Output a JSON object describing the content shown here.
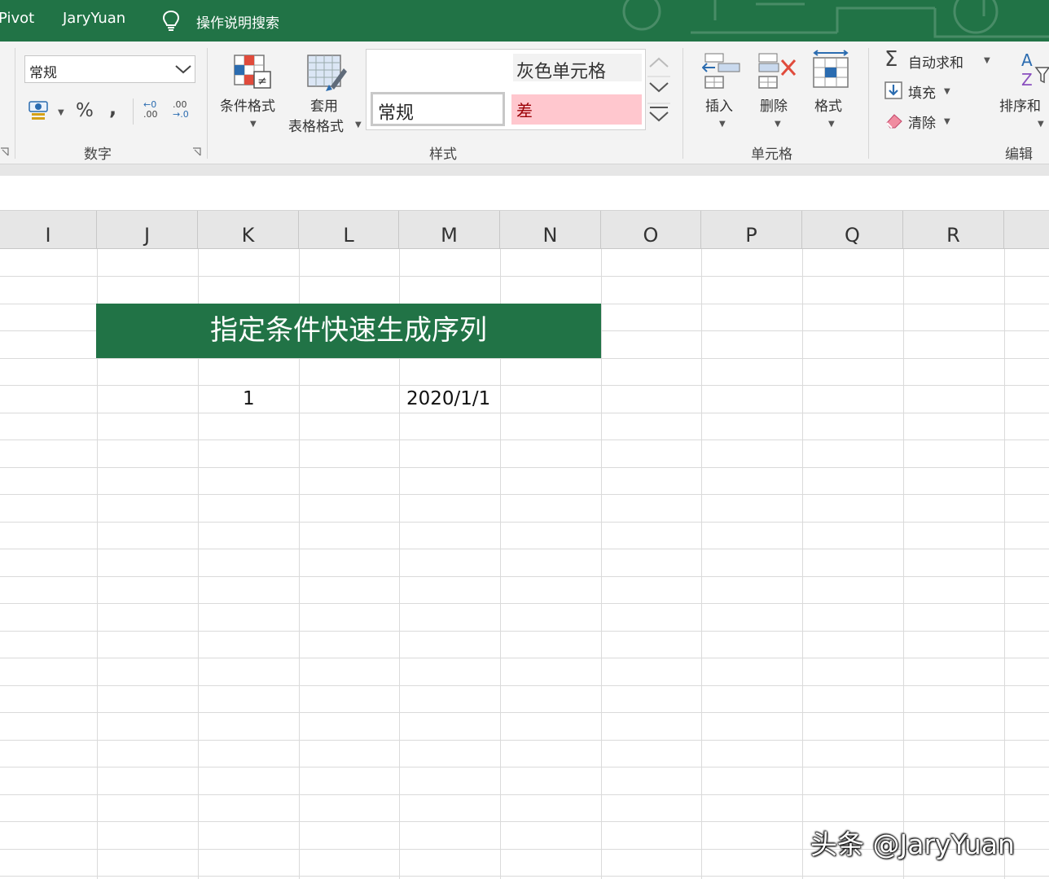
{
  "title_bar": {
    "tabs": [
      "Pivot",
      "JaryYuan"
    ],
    "search_label": "操作说明搜索"
  },
  "ribbon": {
    "number": {
      "format_value": "常规",
      "percent": "%",
      "comma": ",",
      "inc_decimal_top": "←0",
      "inc_decimal_bottom": ".00",
      "dec_decimal_top": ".00",
      "dec_decimal_bottom": "→.0",
      "group_label": "数字"
    },
    "styles": {
      "conditional_format": "条件格式",
      "table_format_line1": "套用",
      "table_format_line2": "表格格式",
      "gray_cell": "灰色单元格",
      "normal": "常规",
      "bad": "差",
      "group_label": "样式"
    },
    "cells": {
      "insert": "插入",
      "delete": "删除",
      "format": "格式",
      "group_label": "单元格"
    },
    "editing": {
      "autosum": "自动求和",
      "fill": "填充",
      "clear": "清除",
      "sort_filter": "排序和",
      "sigma": "Σ",
      "group_label": "编辑"
    }
  },
  "grid": {
    "columns": [
      "I",
      "J",
      "K",
      "L",
      "M",
      "N",
      "O",
      "P",
      "Q",
      "R"
    ],
    "banner_text": "指定条件快速生成序列",
    "cell_k": "1",
    "cell_m": "2020/1/1"
  },
  "colors": {
    "excel_green": "#217346",
    "bad_fill": "#ffc7ce",
    "bad_text": "#9c0006"
  },
  "watermark": "头条 @JaryYuan"
}
